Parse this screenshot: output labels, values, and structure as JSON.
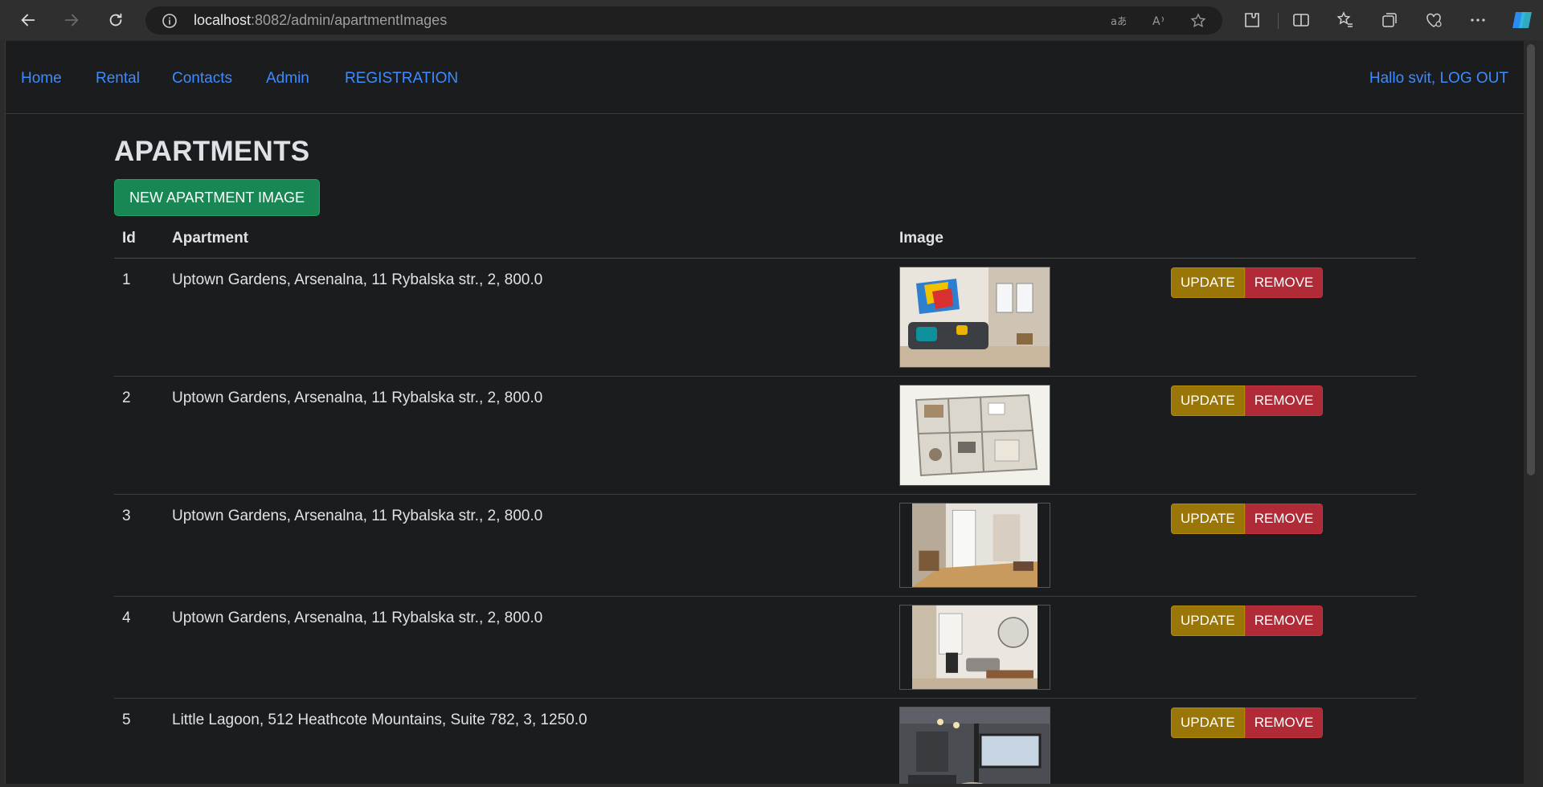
{
  "browser": {
    "url_host": "localhost",
    "url_path": ":8082/admin/apartmentImages"
  },
  "nav": {
    "links": [
      "Home",
      "Rental",
      "Contacts",
      "Admin",
      "REGISTRATION"
    ],
    "user_greeting": "Hallo svit, LOG OUT"
  },
  "page": {
    "title": "APARTMENTS",
    "new_button": "NEW APARTMENT IMAGE"
  },
  "table": {
    "headers": {
      "id": "Id",
      "apartment": "Apartment",
      "image": "Image",
      "actions": ""
    },
    "update_label": "UPDATE",
    "remove_label": "REMOVE",
    "rows": [
      {
        "id": "1",
        "apartment": "Uptown Gardens, Arsenalna, 11 Rybalska str., 2, 800.0",
        "image": "living-room-photo"
      },
      {
        "id": "2",
        "apartment": "Uptown Gardens, Arsenalna, 11 Rybalska str., 2, 800.0",
        "image": "floor-plan-3d-photo"
      },
      {
        "id": "3",
        "apartment": "Uptown Gardens, Arsenalna, 11 Rybalska str., 2, 800.0",
        "image": "hallway-photo"
      },
      {
        "id": "4",
        "apartment": "Uptown Gardens, Arsenalna, 11 Rybalska str., 2, 800.0",
        "image": "living-dining-photo"
      },
      {
        "id": "5",
        "apartment": "Little Lagoon, 512 Heathcote Mountains, Suite 782, 3, 1250.0",
        "image": "tv-room-photo"
      }
    ]
  },
  "colors": {
    "link": "#3d8bfd",
    "success": "#198754",
    "warning": "#9a7608",
    "danger": "#b02a37",
    "page_bg": "#1b1c1e"
  }
}
